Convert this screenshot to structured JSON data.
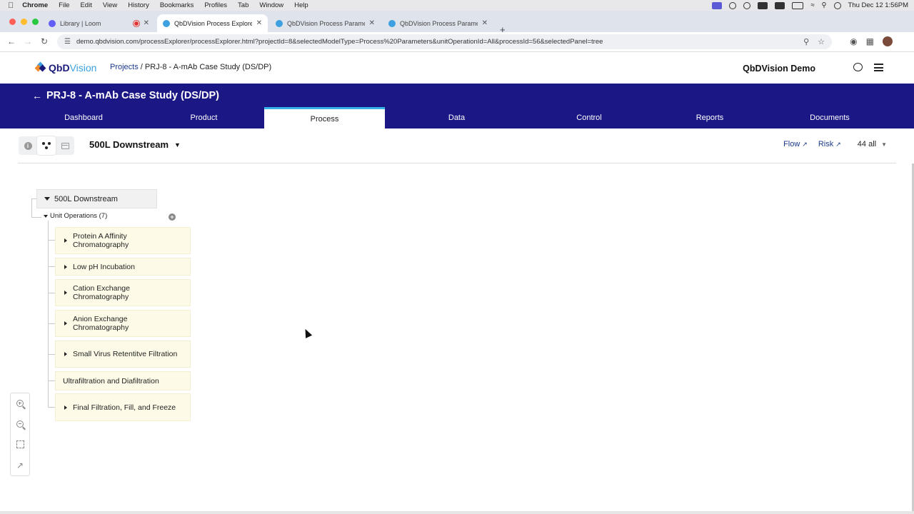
{
  "os_menubar": {
    "apple": "",
    "items": [
      "Chrome",
      "File",
      "Edit",
      "View",
      "History",
      "Bookmarks",
      "Profiles",
      "Tab",
      "Window",
      "Help"
    ],
    "clock": "Thu Dec 12  1:56PM"
  },
  "browser": {
    "tabs": [
      {
        "label": "Library | Loom",
        "favicon_color": "#625df5"
      },
      {
        "label": "QbDVision Process Explorer",
        "favicon_color": "#3da0e0"
      },
      {
        "label": "QbDVision Process Parameter",
        "favicon_color": "#3da0e0"
      },
      {
        "label": "QbDVision Process Parameter",
        "favicon_color": "#3da0e0"
      }
    ],
    "new_tab": "+",
    "url": "demo.qbdvision.com/processExplorer/processExplorer.html?projectId=8&selectedModelType=Process%20Parameters&unitOperationId=All&processId=56&selectedPanel=tree"
  },
  "app": {
    "logo_part1": "QbD",
    "logo_part2": "Vision",
    "breadcrumb_link": "Projects",
    "breadcrumb_current": " / PRJ-8 - A-mAb Case Study (DS/DP)",
    "account_name": "QbDVision Demo",
    "project_title": "PRJ-8 - A-mAb Case Study (DS/DP)",
    "back_arrow": "←",
    "nav_tabs": [
      "Dashboard",
      "Product",
      "Process",
      "Data",
      "Control",
      "Reports",
      "Documents"
    ],
    "active_tab": "Process"
  },
  "explorer": {
    "info_glyph": "i",
    "process_name": "500L Downstream",
    "flow_label": "Flow",
    "risk_label": "Risk",
    "filter_label": "44 all",
    "tree": {
      "root": "500L Downstream",
      "group": "Unit Operations (7)",
      "add_glyph": "+",
      "unit_operations": [
        {
          "label": "Protein A Affinity Chromatography",
          "expandable": true
        },
        {
          "label": "Low pH Incubation",
          "expandable": true
        },
        {
          "label": "Cation Exchange Chromatography",
          "expandable": true
        },
        {
          "label": "Anion Exchange Chromatography",
          "expandable": true
        },
        {
          "label": "Small Virus Retentitve Filtration",
          "expandable": true
        },
        {
          "label": "Ultrafiltration and Diafiltration",
          "expandable": false
        },
        {
          "label": "Final Filtration, Fill, and Freeze",
          "expandable": true
        }
      ]
    }
  },
  "colors": {
    "banner": "#1b1785",
    "active_tab_accent": "#33b3e8",
    "unit_op_bg": "#fdfbe7",
    "link": "#1a3a8a"
  }
}
